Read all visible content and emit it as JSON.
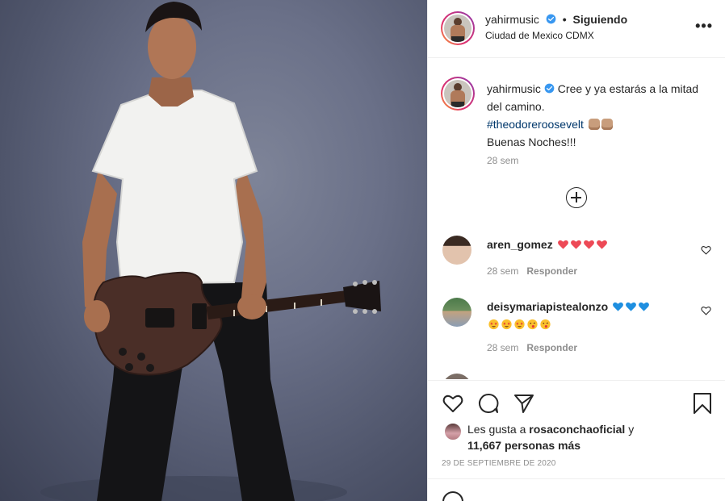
{
  "post": {
    "username": "yahirmusic",
    "follow_status": "Siguiendo",
    "location": "Ciudad de Mexico CDMX",
    "more_label": "•••"
  },
  "caption": {
    "username": "yahirmusic",
    "text_line1": "Cree y ya estarás a la mitad del camino.",
    "hashtag": "#theodoreroosevelt",
    "text_line3": "Buenas Noches!!!",
    "time": "28 sem"
  },
  "comments": [
    {
      "username": "aren_gomez",
      "time": "28 sem",
      "reply_label": "Responder",
      "emoji": "red-hearts"
    },
    {
      "username": "deisymariapistealonzo",
      "time": "28 sem",
      "reply_label": "Responder",
      "emoji": "blue-hearts-star-eyes"
    }
  ],
  "likes": {
    "prefix": "Les gusta a",
    "user": "rosaconchaoficial",
    "joiner": "y",
    "count": "11,667 personas más"
  },
  "date": "29 DE SEPTIEMBRE DE 2020",
  "colors": {
    "verified": "#3897f0",
    "heart_red": "#ed4956",
    "heart_blue": "#1f8fe0",
    "hashtag": "#00376b",
    "muted": "#8e8e8e"
  }
}
